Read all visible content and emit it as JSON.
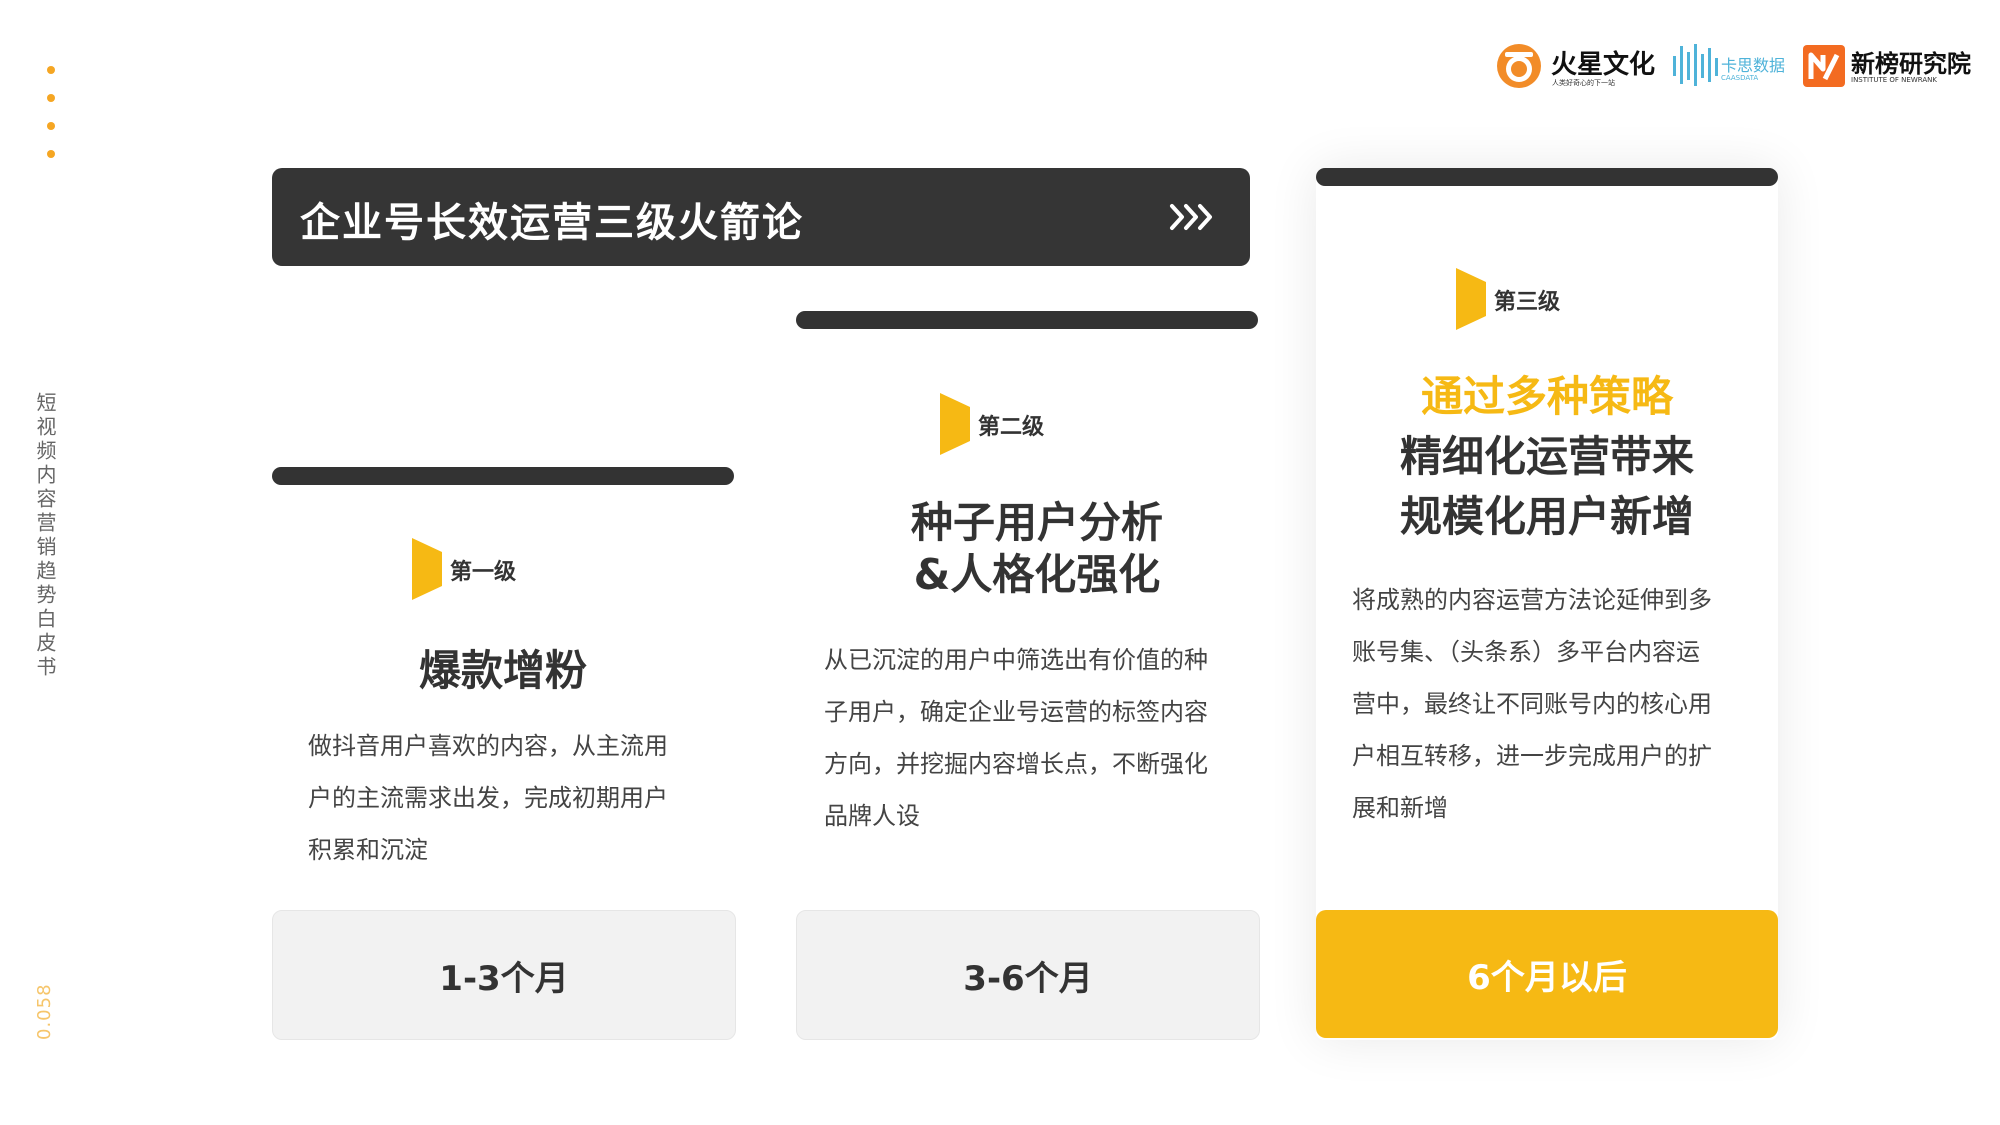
{
  "colors": {
    "accent": "#f6b914",
    "dark": "#353535",
    "dots": "#f5a623",
    "page_num": "#f6c56a"
  },
  "sidebar": {
    "title": "短视频内容营销趋势白皮书",
    "page_number": "0.058"
  },
  "header_logos": [
    {
      "name": "火星文化",
      "sub": "人类好奇心的下一站",
      "icon": "mars-culture-logo-icon"
    },
    {
      "name": "卡思数据",
      "sub": "CAASDATA",
      "icon": "caasdata-logo-icon"
    },
    {
      "name": "新榜研究院",
      "sub": "INSTITUTE OF NEWRANK",
      "icon": "newrank-logo-icon"
    }
  ],
  "main": {
    "title": "企业号长效运营三级火箭论",
    "title_icon": "triple-chevron-right-icon"
  },
  "cards": [
    {
      "level": "第一级",
      "heading_lines": [
        "爆款增粉"
      ],
      "desc_lines": [
        "做抖音用户喜欢的内容，从主流用",
        "户的主流需求出发，完成初期用户",
        "积累和沉淀"
      ],
      "duration": "1-3个月"
    },
    {
      "level": "第二级",
      "heading_lines": [
        "种子用户分析",
        "&人格化强化"
      ],
      "desc_lines": [
        "从已沉淀的用户中筛选出有价值的种",
        "子用户，确定企业号运营的标签内容",
        "方向，并挖掘内容增长点，不断强化",
        "品牌人设"
      ],
      "duration": "3-6个月"
    },
    {
      "level": "第三级",
      "heading_highlight": "通过多种策略",
      "heading_lines": [
        "精细化运营带来",
        "规模化用户新增"
      ],
      "desc_lines": [
        "将成熟的内容运营方法论延伸到多",
        "账号集、（头条系）多平台内容运",
        "营中，最终让不同账号内的核心用",
        "户相互转移，进一步完成用户的扩",
        "展和新增"
      ],
      "duration": "6个月以后"
    }
  ]
}
